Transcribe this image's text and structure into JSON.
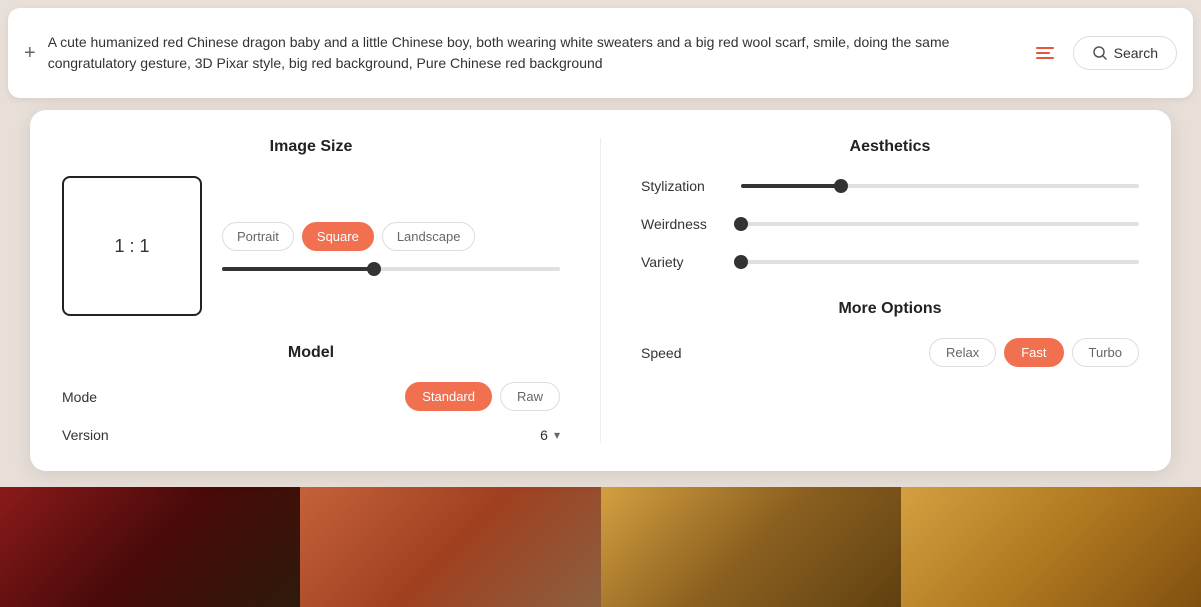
{
  "topbar": {
    "plus_label": "+",
    "prompt_text": "A cute humanized red Chinese dragon baby and a little Chinese boy, both wearing white sweaters and a big red wool scarf, smile, doing the same congratulatory gesture, 3D Pixar style, big red background, Pure Chinese red background",
    "search_label": "Search"
  },
  "imageSize": {
    "section_title": "Image Size",
    "aspect_ratio": "1 : 1",
    "orientations": [
      {
        "label": "Portrait",
        "active": false
      },
      {
        "label": "Square",
        "active": true
      },
      {
        "label": "Landscape",
        "active": false
      }
    ],
    "slider_position_pct": 45
  },
  "model": {
    "section_title": "Model",
    "mode_label": "Mode",
    "modes": [
      {
        "label": "Standard",
        "active": true
      },
      {
        "label": "Raw",
        "active": false
      }
    ],
    "version_label": "Version",
    "version_value": "6"
  },
  "aesthetics": {
    "section_title": "Aesthetics",
    "sliders": [
      {
        "label": "Stylization",
        "position_pct": 25
      },
      {
        "label": "Weirdness",
        "position_pct": 0
      },
      {
        "label": "Variety",
        "position_pct": 0
      }
    ]
  },
  "moreOptions": {
    "section_title": "More Options",
    "speed_label": "Speed",
    "speeds": [
      {
        "label": "Relax",
        "active": false
      },
      {
        "label": "Fast",
        "active": true
      },
      {
        "label": "Turbo",
        "active": false
      }
    ]
  }
}
